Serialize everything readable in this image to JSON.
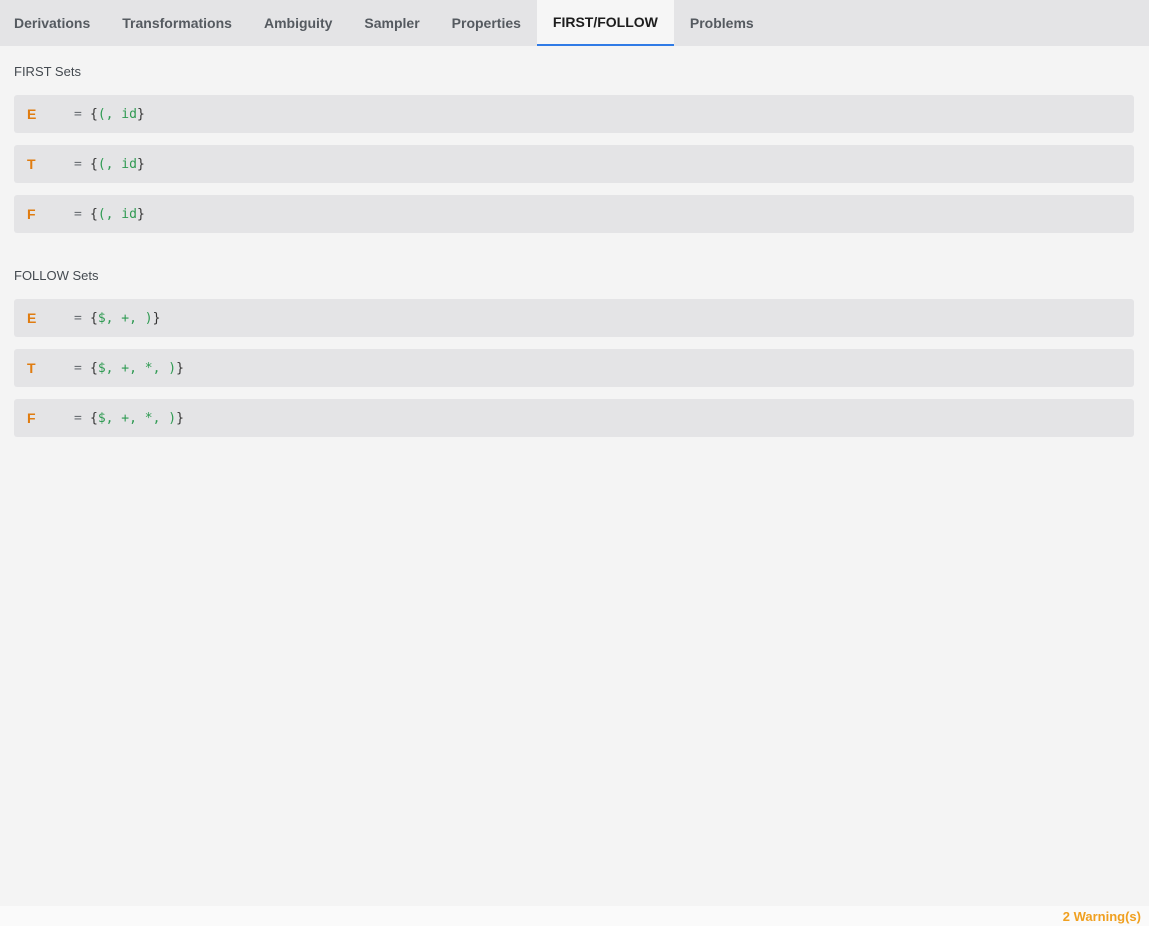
{
  "tabs": [
    {
      "label": "Derivations"
    },
    {
      "label": "Transformations"
    },
    {
      "label": "Ambiguity"
    },
    {
      "label": "Sampler"
    },
    {
      "label": "Properties"
    },
    {
      "label": "FIRST/FOLLOW",
      "active": true
    },
    {
      "label": "Problems"
    }
  ],
  "first": {
    "title": "FIRST Sets",
    "rows": [
      {
        "symbol": "E",
        "eq": "=",
        "open": "{",
        "items": "(, id",
        "close": "}"
      },
      {
        "symbol": "T",
        "eq": "=",
        "open": "{",
        "items": "(, id",
        "close": "}"
      },
      {
        "symbol": "F",
        "eq": "=",
        "open": "{",
        "items": "(, id",
        "close": "}"
      }
    ]
  },
  "follow": {
    "title": "FOLLOW Sets",
    "rows": [
      {
        "symbol": "E",
        "eq": "=",
        "open": "{",
        "items": "$, +, )",
        "close": "}"
      },
      {
        "symbol": "T",
        "eq": "=",
        "open": "{",
        "items": "$, +, *, )",
        "close": "}"
      },
      {
        "symbol": "F",
        "eq": "=",
        "open": "{",
        "items": "$, +, *, )",
        "close": "}"
      }
    ]
  },
  "status": {
    "warnings": "2 Warning(s)"
  },
  "colors": {
    "accent": "#2f7be6",
    "symbol": "#e07c10",
    "set_item": "#2e9a52",
    "warning": "#f0a020"
  }
}
